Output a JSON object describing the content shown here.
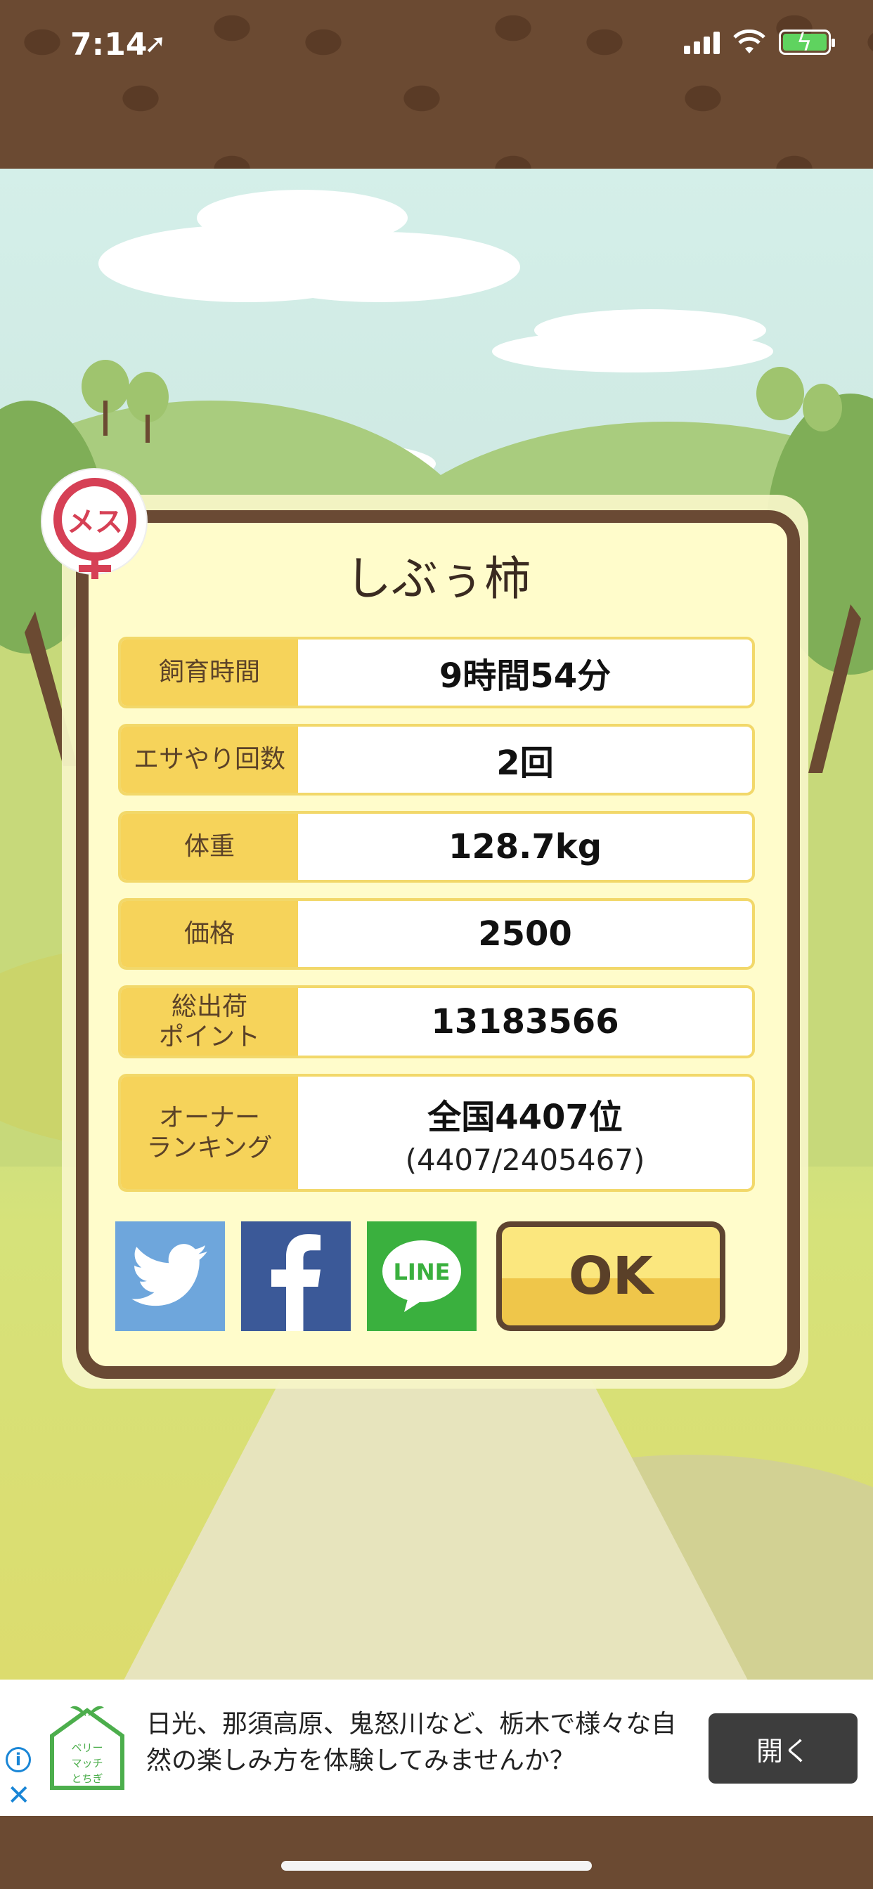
{
  "status_bar": {
    "time": "7:14",
    "location_icon": "location-arrow-icon",
    "signal_icon": "cellular-signal-icon",
    "wifi_icon": "wifi-icon",
    "battery_icon": "battery-charging-icon"
  },
  "dialog": {
    "badge_label": "メス",
    "pig_name": "しぶぅ柿",
    "rows": [
      {
        "label": "飼育時間",
        "value": "9時間54分"
      },
      {
        "label": "エサやり回数",
        "value": "2回"
      },
      {
        "label": "体重",
        "value": "128.7kg"
      },
      {
        "label": "価格",
        "value": "2500"
      },
      {
        "label": "総出荷\nポイント",
        "value": "13183566"
      },
      {
        "label": "オーナー\nランキング",
        "value": "全国4407位",
        "sub": "(4407/2405467)"
      }
    ],
    "share_twitter_icon": "twitter-icon",
    "share_facebook_icon": "facebook-icon",
    "share_line_icon": "line-icon",
    "line_text": "LINE",
    "ok_label": "OK"
  },
  "ad": {
    "logo_text": "ベリーマッチとちぎ",
    "text": "日光、那須高原、鬼怒川など、栃木で様々な自然の楽しみ方を体験してみませんか？",
    "open_label": "開く",
    "info_icon": "info-icon",
    "close_icon": "close-icon"
  },
  "colors": {
    "background_brown": "#6b4a32",
    "dialog_border": "#6a4a34",
    "label_yellow": "#f6d35a",
    "twitter": "#6ea6dc",
    "facebook": "#3b5998",
    "line": "#3ab03e",
    "female_badge": "#d64055"
  }
}
